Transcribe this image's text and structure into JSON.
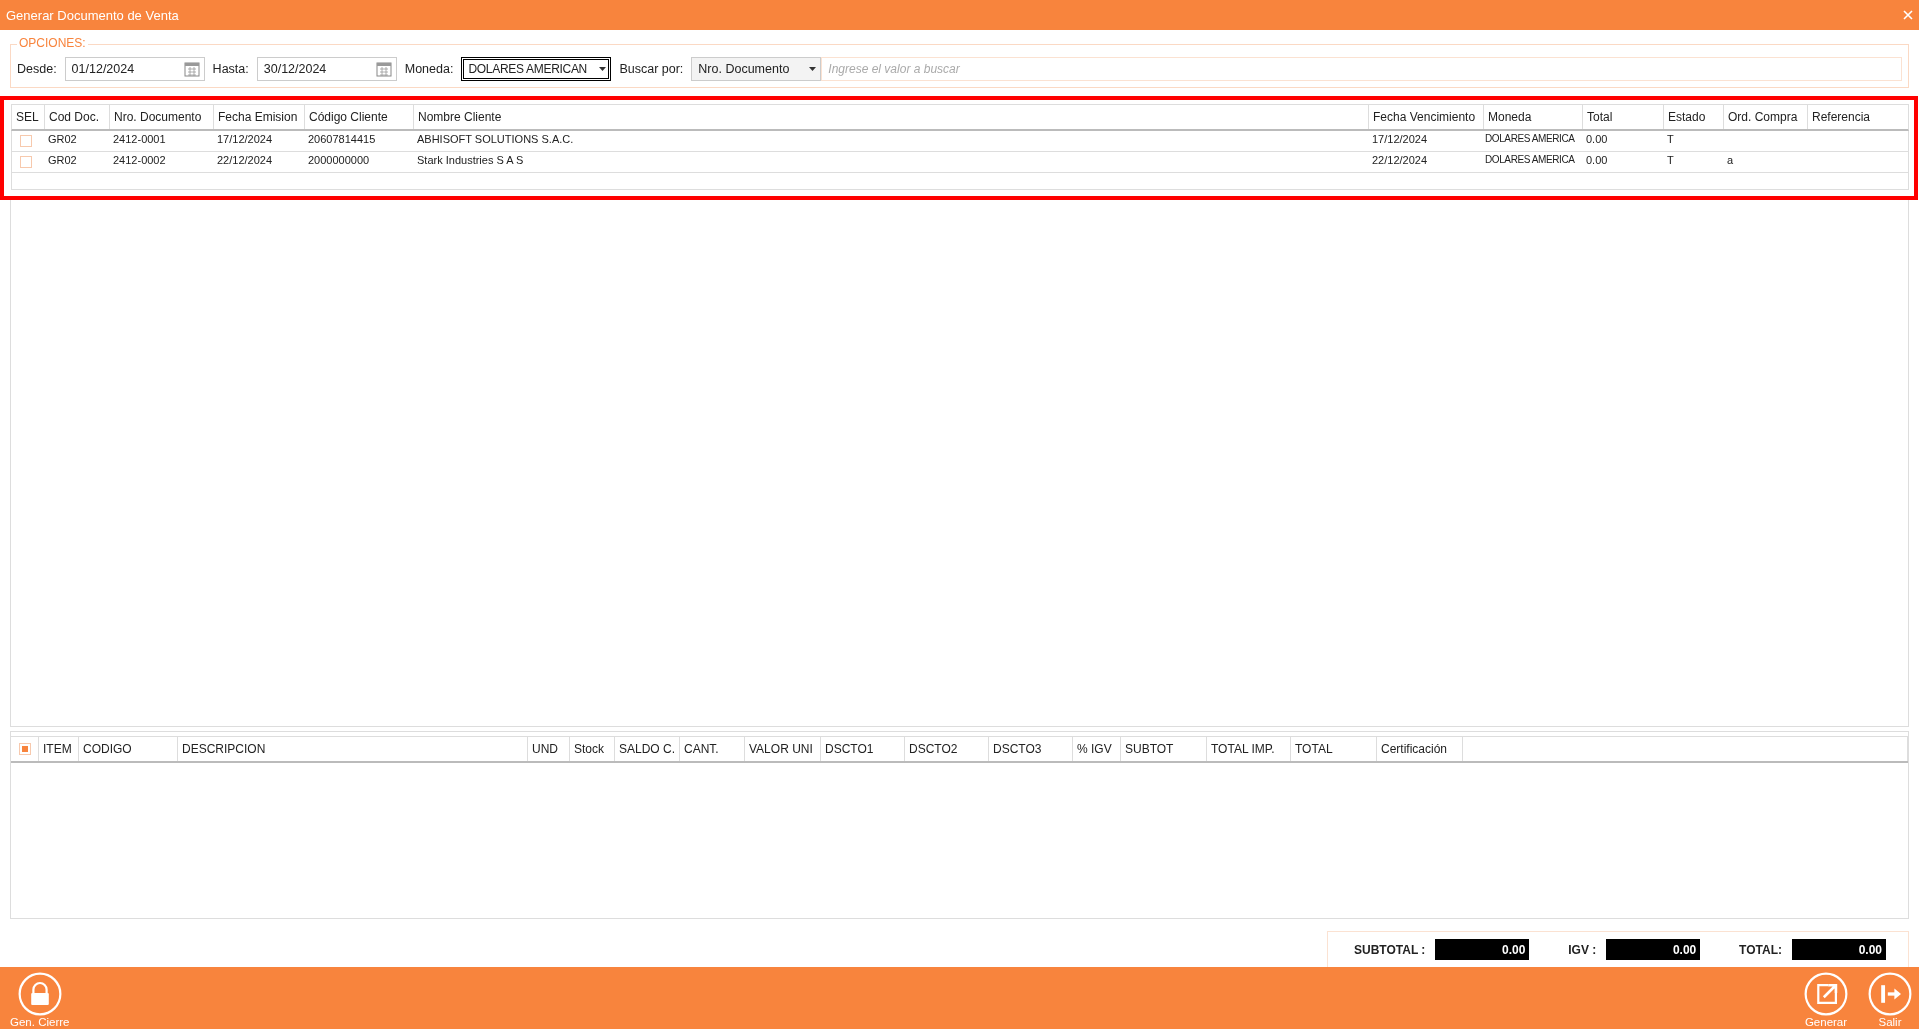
{
  "window": {
    "title": "Generar Documento de Venta"
  },
  "options": {
    "legend": "OPCIONES:",
    "fields": [
      {
        "kind": "date",
        "label": "Desde:",
        "value": "01/12/2024",
        "focused": false
      },
      {
        "kind": "date",
        "label": "Hasta:",
        "value": "30/12/2024",
        "focused": false
      },
      {
        "kind": "select",
        "label": "Moneda:",
        "value": "DOLARES AMERICAN",
        "focused": true
      },
      {
        "kind": "select",
        "label": "Buscar por:",
        "value": "Nro. Documento",
        "focused": false
      }
    ],
    "search": {
      "placeholder": "Ingrese el valor a buscar"
    }
  },
  "documents": {
    "columns": [
      "SEL",
      "Cod Doc.",
      "Nro. Documento",
      "Fecha Emision",
      "Código Cliente",
      "Nombre Cliente",
      "Fecha Vencimiento",
      "Moneda",
      "Total",
      "Estado",
      "Ord. Compra",
      "Referencia"
    ],
    "rows": [
      {
        "selected": false,
        "cells": [
          "",
          "GR02",
          "2412-0001",
          "17/12/2024",
          "20607814415",
          "ABHISOFT SOLUTIONS S.A.C.",
          "17/12/2024",
          "DOLARES AMERICA",
          "0.00",
          "T",
          "",
          ""
        ]
      },
      {
        "selected": false,
        "cells": [
          "",
          "GR02",
          "2412-0002",
          "22/12/2024",
          "2000000000",
          "Stark Industries S A S",
          "22/12/2024",
          "DOLARES AMERICA",
          "0.00",
          "T",
          "a",
          ""
        ]
      }
    ]
  },
  "detail": {
    "all_checked": true,
    "columns": [
      "ITEM",
      "CODIGO",
      "DESCRIPCION",
      "UND",
      "Stock",
      "SALDO C.",
      "CANT.",
      "VALOR UNI",
      "DSCTO1",
      "DSCTO2",
      "DSCTO3",
      "% IGV",
      "SUBTOT",
      "TOTAL IMP.",
      "TOTAL",
      "Certificación"
    ]
  },
  "totals": [
    {
      "label": "SUBTOTAL :",
      "value": "0.00"
    },
    {
      "label": "IGV :",
      "value": "0.00"
    },
    {
      "label": "TOTAL:",
      "value": "0.00"
    }
  ],
  "footer": {
    "left": [
      {
        "label": "Gen. Cierre"
      }
    ],
    "right": [
      {
        "label": "Generar"
      },
      {
        "label": "Salir"
      }
    ]
  }
}
